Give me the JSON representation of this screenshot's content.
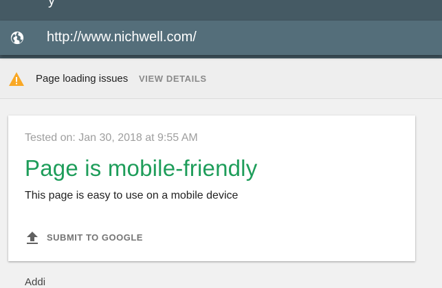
{
  "header": {
    "title_partial": "y"
  },
  "urlbar": {
    "url": "http://www.nichwell.com/",
    "icon": "globe-icon"
  },
  "warning": {
    "icon": "warning-icon",
    "icon_color": "#f9a825",
    "text": "Page loading issues",
    "link_label": "VIEW DETAILS"
  },
  "result": {
    "tested_on": "Tested on: Jan 30, 2018 at 9:55 AM",
    "title": "Page is mobile-friendly",
    "title_color": "#1e9d5a",
    "description": "This page is easy to use on a mobile device",
    "submit_label": "SUBMIT TO GOOGLE",
    "submit_icon": "upload-icon"
  },
  "below": {
    "partial_text": "Addi"
  }
}
